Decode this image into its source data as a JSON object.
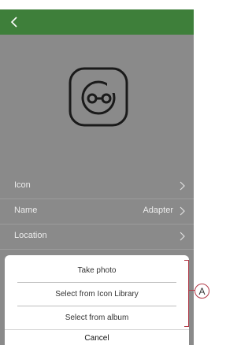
{
  "header": {
    "back_icon": "chevron-left-icon"
  },
  "device": {
    "icon": "adapter-icon"
  },
  "rows": [
    {
      "label": "Icon",
      "value": ""
    },
    {
      "label": "Name",
      "value": "Adapter"
    },
    {
      "label": "Location",
      "value": ""
    }
  ],
  "sheet": {
    "options": [
      "Take photo",
      "Select from Icon Library",
      "Select from album"
    ],
    "cancel": "Cancel"
  },
  "callout": {
    "label": "A"
  },
  "colors": {
    "appbar": "#3e7f3a",
    "overlay": "#8a8a8a",
    "callout": "#b23a48"
  }
}
